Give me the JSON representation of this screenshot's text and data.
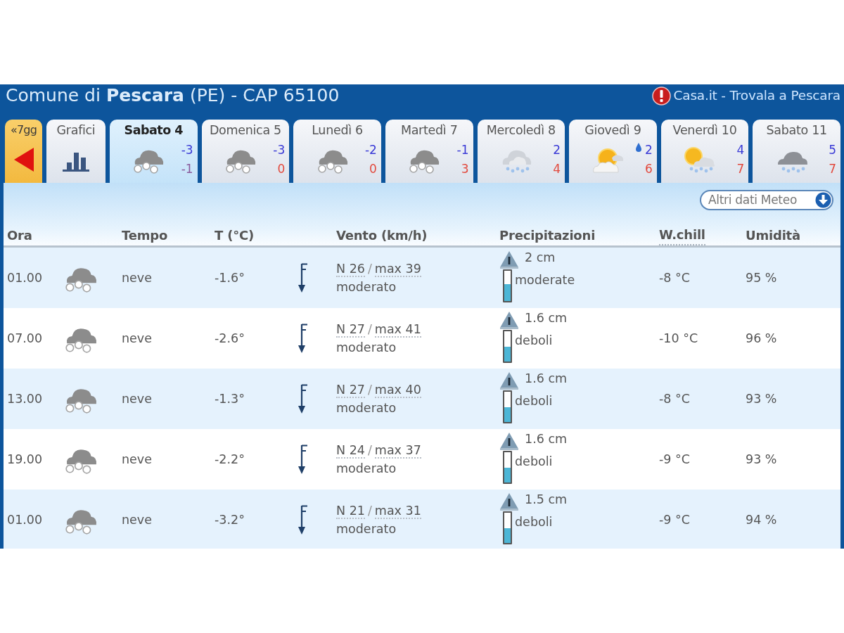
{
  "header": {
    "title": "Comune di **Pescara** (PE) - CAP 65100",
    "link": "Casa.it - Trovala a Pescara"
  },
  "tabs": [
    {
      "kind": "back",
      "label": "«7gg",
      "selected": false
    },
    {
      "kind": "charts",
      "label": "Grafici",
      "selected": false
    },
    {
      "kind": "day",
      "label": "Sabato 4",
      "selected": true,
      "forecast": {
        "kind": "snow",
        "min": "-3",
        "max": {
          "text": "-1",
          "color": "#8a5a9c"
        },
        "drop": false
      }
    },
    {
      "kind": "day",
      "label": "Domenica 5",
      "selected": false,
      "forecast": {
        "kind": "snow",
        "min": "-3",
        "max": {
          "text": "0",
          "color": "#e24a3e"
        },
        "drop": false
      }
    },
    {
      "kind": "day",
      "label": "Lunedì 6",
      "selected": false,
      "forecast": {
        "kind": "snow",
        "min": "-2",
        "max": {
          "text": "0",
          "color": "#e24a3e"
        },
        "drop": false
      }
    },
    {
      "kind": "day",
      "label": "Martedì 7",
      "selected": false,
      "forecast": {
        "kind": "snow",
        "min": "-1",
        "max": {
          "text": "3",
          "color": "#e24a3e"
        },
        "drop": false
      }
    },
    {
      "kind": "day",
      "label": "Mercoledì 8",
      "selected": false,
      "forecast": {
        "kind": "sleet",
        "min": "2",
        "max": {
          "text": "4",
          "color": "#e24a3e"
        },
        "drop": false
      }
    },
    {
      "kind": "day",
      "label": "Giovedì 9",
      "selected": false,
      "forecast": {
        "kind": "suncloud",
        "min": "2",
        "max": {
          "text": "6",
          "color": "#e24a3e"
        },
        "drop": true
      }
    },
    {
      "kind": "day",
      "label": "Venerdì 10",
      "selected": false,
      "forecast": {
        "kind": "sunsnow",
        "min": "4",
        "max": {
          "text": "7",
          "color": "#e24a3e"
        },
        "drop": false
      }
    },
    {
      "kind": "day",
      "label": "Sabato 11",
      "selected": false,
      "forecast": {
        "kind": "cloudsnow",
        "min": "5",
        "max": {
          "text": "7",
          "color": "#e24a3e"
        },
        "drop": false
      }
    }
  ],
  "more_button": "Altri dati Meteo",
  "table": {
    "columns": [
      {
        "label": "Ora",
        "abbreviation": false
      },
      {
        "label": "Tempo",
        "abbreviation": false
      },
      {
        "label": "T (°C)",
        "abbreviation": false
      },
      {
        "label": "Vento (km/h)",
        "abbreviation": false
      },
      {
        "label": "Precipitazioni",
        "abbreviation": false
      },
      {
        "label": "W.chill",
        "abbreviation": true
      },
      {
        "label": "Umidità",
        "abbreviation": false
      }
    ],
    "rows": [
      {
        "time": "01.00",
        "weather": "neve",
        "temperature": "-1.6°",
        "wind": "N 26",
        "wind_separator": "/",
        "gust": "max 39",
        "wind_strength": "moderato",
        "amount": "2 cm",
        "intensity": "moderate",
        "level": 0.55,
        "wind_chill": "-8 °C",
        "humidity": "95 %"
      },
      {
        "time": "07.00",
        "weather": "neve",
        "temperature": "-2.6°",
        "wind": "N 27",
        "wind_separator": "/",
        "gust": "max 41",
        "wind_strength": "moderato",
        "amount": "1.6 cm",
        "intensity": "deboli",
        "level": 0.5,
        "wind_chill": "-10 °C",
        "humidity": "96 %"
      },
      {
        "time": "13.00",
        "weather": "neve",
        "temperature": "-1.3°",
        "wind": "N 27",
        "wind_separator": "/",
        "gust": "max 40",
        "wind_strength": "moderato",
        "amount": "1.6 cm",
        "intensity": "deboli",
        "level": 0.5,
        "wind_chill": "-8 °C",
        "humidity": "93 %"
      },
      {
        "time": "19.00",
        "weather": "neve",
        "temperature": "-2.2°",
        "wind": "N 24",
        "wind_separator": "/",
        "gust": "max 37",
        "wind_strength": "moderato",
        "amount": "1.6 cm",
        "intensity": "deboli",
        "level": 0.5,
        "wind_chill": "-9 °C",
        "humidity": "93 %"
      },
      {
        "time": "01.00",
        "weather": "neve",
        "temperature": "-3.2°",
        "wind": "N 21",
        "wind_separator": "/",
        "gust": "max 31",
        "wind_strength": "moderato",
        "amount": "1.5 cm",
        "intensity": "deboli",
        "level": 0.5,
        "wind_chill": "-9 °C",
        "humidity": "94 %"
      }
    ]
  }
}
